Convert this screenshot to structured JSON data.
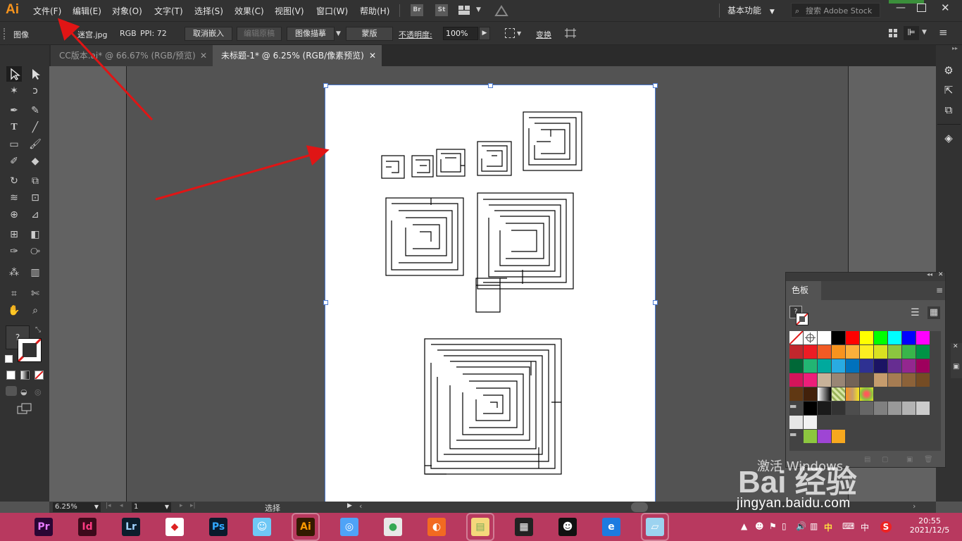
{
  "app": {
    "logo": "Ai"
  },
  "menu": [
    "文件(F)",
    "编辑(E)",
    "对象(O)",
    "文字(T)",
    "选择(S)",
    "效果(C)",
    "视图(V)",
    "窗口(W)",
    "帮助(H)"
  ],
  "menu_bar": {
    "bridge_label": "Br",
    "stock_label": "St",
    "workspace": "基本功能",
    "search_placeholder": "搜索 Adobe Stock"
  },
  "control_bar": {
    "type_label": "图像",
    "file_name": "迷宫.jpg",
    "color_mode": "RGB",
    "ppi": "PPI: 72",
    "unembed_button": "取消嵌入",
    "edit_original_button": "编辑原稿",
    "image_trace_button": "图像描摹",
    "mask_button": "蒙版",
    "opacity_label": "不透明度:",
    "opacity_value": "100%",
    "transform_label": "变换"
  },
  "tabs": [
    {
      "label": "CC版本.ai* @ 66.67% (RGB/预览)",
      "active": false
    },
    {
      "label": "未标题-1* @ 6.25% (RGB/像素预览)",
      "active": true
    }
  ],
  "swatches_panel": {
    "title": "色板",
    "rows": [
      [
        "#ffffff",
        "#ffffff",
        "#ffffff",
        "#000000",
        "#ff0000",
        "#ffff00",
        "#00ff00",
        "#00ffff",
        "#0000ff",
        "#ff00ff"
      ],
      [
        "#c1272d",
        "#ed1c24",
        "#f15a24",
        "#f7931e",
        "#fbb03b",
        "#fcee21",
        "#d9e021",
        "#8cc63f",
        "#39b54a",
        "#009245"
      ],
      [
        "#006837",
        "#22b573",
        "#00a99d",
        "#29abe2",
        "#0071bc",
        "#2e3192",
        "#1b1464",
        "#662d91",
        "#93278f",
        "#9e005d"
      ],
      [
        "#d4145a",
        "#ed1e79",
        "#c7b299",
        "#998675",
        "#736357",
        "#534741",
        "#c69c6d",
        "#a67c52",
        "#8c6239",
        "#754c24"
      ],
      [
        "#603813",
        "#42210b",
        "#808080",
        "#b3b3b3",
        "#f7931e",
        "#8cc63f"
      ],
      [
        "#000000",
        "#1a1a1a",
        "#333333",
        "#4d4d4d",
        "#666666",
        "#808080",
        "#999999",
        "#b3b3b3",
        "#cccccc"
      ],
      [
        "#e6e6e6",
        "#f2f2f2"
      ],
      [
        "#8cc63f",
        "#9e45d4",
        "#f7a81e"
      ]
    ]
  },
  "status_bar": {
    "zoom": "6.25%",
    "page": "1",
    "tool": "选择"
  },
  "watermark": {
    "text": "Bai 经验",
    "sub": "jingyan.baidu.com",
    "activate": "激活 Windows"
  },
  "taskbar": {
    "apps": [
      {
        "label": "Pr",
        "bg": "#2a0634",
        "fg": "#e77bff"
      },
      {
        "label": "Id",
        "bg": "#3d0a1b",
        "fg": "#ff3b82"
      },
      {
        "label": "Lr",
        "bg": "#0b1d2c",
        "fg": "#9fd1ff"
      },
      {
        "label": "◆",
        "bg": "#ffffff",
        "fg": "#d22"
      },
      {
        "label": "Ps",
        "bg": "#0a1a2c",
        "fg": "#31a8ff"
      },
      {
        "label": "☺",
        "bg": "#6fc8f5",
        "fg": "#fff"
      },
      {
        "label": "Ai",
        "bg": "#331a00",
        "fg": "#ff9a00"
      },
      {
        "label": "◎",
        "bg": "#4fa3f7",
        "fg": "#fff"
      },
      {
        "label": "●",
        "bg": "#e8e8e8",
        "fg": "#34a853"
      },
      {
        "label": "◐",
        "bg": "#f26a21",
        "fg": "#fff"
      },
      {
        "label": "▤",
        "bg": "#f5d77b",
        "fg": "#7a5"
      },
      {
        "label": "▦",
        "bg": "#222",
        "fg": "#fff"
      },
      {
        "label": "☻",
        "bg": "#111",
        "fg": "#fff"
      },
      {
        "label": "e",
        "bg": "#1d7be0",
        "fg": "#fff"
      },
      {
        "label": "▱",
        "bg": "#9cd3f0",
        "fg": "#fff"
      }
    ],
    "ime": "中",
    "ime2": "中",
    "time": "20:55",
    "date": "2021/12/5"
  }
}
